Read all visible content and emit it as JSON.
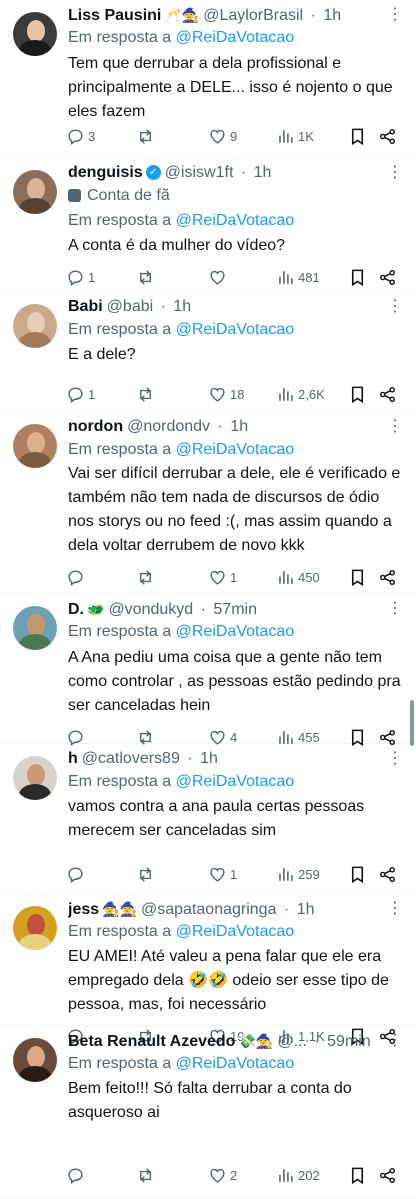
{
  "reply_prefix": "Em resposta a",
  "tweets": [
    {
      "name": "Liss Pausini",
      "emoji": "🥂🧙",
      "verified": false,
      "handle": "@LaylorBrasil",
      "time": "1h",
      "fan": "",
      "mention": "@ReiDaVotacao",
      "text": "Tem que derrubar a dela profissional e principalmente a DELE... isso é nojento o que eles fazem",
      "replies": "3",
      "retweets": "",
      "likes": "9",
      "views": "1K",
      "avatar_colors": [
        "#3b3b3b",
        "#e8c4a8",
        "#1a1a1a"
      ]
    },
    {
      "name": "denguisis",
      "emoji": "",
      "verified": true,
      "handle": "@isisw1ft",
      "time": "1h",
      "fan": "Conta de fã",
      "mention": "@ReiDaVotacao",
      "text": "A conta é da mulher do vídeo?",
      "replies": "1",
      "retweets": "",
      "likes": "",
      "views": "481",
      "avatar_colors": [
        "#8a6d5a",
        "#d9b39a",
        "#5a4030"
      ]
    },
    {
      "name": "Babi",
      "emoji": "",
      "verified": false,
      "handle": "@babi",
      "time": "1h",
      "fan": "",
      "mention": "@ReiDaVotacao",
      "text": "E a dele?",
      "replies": "1",
      "retweets": "",
      "likes": "18",
      "views": "2,6K",
      "avatar_colors": [
        "#c9a98a",
        "#e6cdb5",
        "#a07a5a"
      ]
    },
    {
      "name": "nordon",
      "emoji": "",
      "verified": false,
      "handle": "@nordondv",
      "time": "1h",
      "fan": "",
      "mention": "@ReiDaVotacao",
      "text": "Vai ser difícil derrubar a dele, ele é verificado e também não tem nada de discursos de ódio nos storys ou no feed :(, mas assim quando a dela voltar derrubem de novo kkk",
      "replies": "",
      "retweets": "",
      "likes": "1",
      "views": "450",
      "avatar_colors": [
        "#b08060",
        "#d9b08a",
        "#7a5a40"
      ]
    },
    {
      "name": "D.",
      "emoji": "🐲",
      "verified": false,
      "handle": "@vondukyd",
      "time": "57min",
      "fan": "",
      "mention": "@ReiDaVotacao",
      "text": "A Ana pediu uma coisa que a gente não tem como controlar , as pessoas estão pedindo pra ser canceladas hein",
      "replies": "",
      "retweets": "",
      "likes": "4",
      "views": "455",
      "avatar_colors": [
        "#6fa0b8",
        "#c49a6c",
        "#4a7a50"
      ]
    },
    {
      "name": "h",
      "emoji": "",
      "verified": false,
      "handle": "@catlovers89",
      "time": "1h",
      "fan": "",
      "mention": "@ReiDaVotacao",
      "text": "vamos contra a ana paula certas pessoas merecem ser canceladas sim",
      "replies": "",
      "retweets": "",
      "likes": "1",
      "views": "259",
      "avatar_colors": [
        "#d8d2cc",
        "#c99a7a",
        "#2a2a2a"
      ]
    },
    {
      "name": "jess",
      "emoji": "🧙🧙",
      "verified": false,
      "handle": "@sapataonagringa",
      "time": "1h",
      "fan": "",
      "mention": "@ReiDaVotacao",
      "text": "EU AMEI! Até valeu a pena falar que ele era empregado dela 🤣🤣 odeio ser esse tipo de pessoa, mas, foi necessário",
      "replies": "",
      "retweets": "",
      "likes": "19",
      "views": "1,1K",
      "avatar_colors": [
        "#d4a020",
        "#c05040",
        "#e8d080"
      ]
    },
    {
      "name": "Beta Renault Azevedo",
      "emoji": "💸🧙",
      "verified": false,
      "handle": "@...",
      "time": "59min",
      "fan": "",
      "mention": "@ReiDaVotacao",
      "text": "Bem feito!!! Só falta derrubar a conta do asqueroso ai",
      "replies": "",
      "retweets": "",
      "likes": "2",
      "views": "202",
      "avatar_colors": [
        "#6a4a3a",
        "#d9a888",
        "#2a1a14"
      ]
    }
  ]
}
